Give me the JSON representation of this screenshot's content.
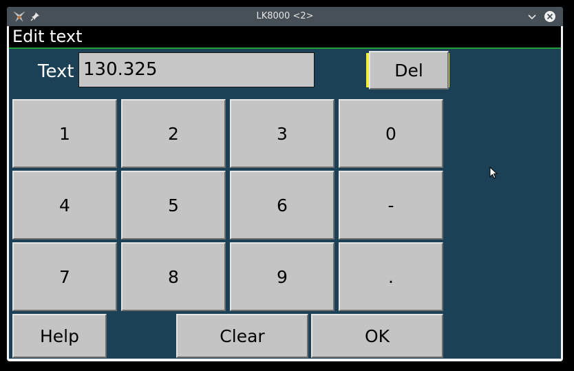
{
  "window": {
    "title": "LK8000 <2>",
    "icons": {
      "app": "app-logo-icon",
      "pin": "pin-icon",
      "minimize": "chevron-down-icon",
      "close": "close-icon"
    }
  },
  "dialog": {
    "title": "Edit text",
    "text_label": "Text",
    "text_value": "130.325",
    "keys": {
      "del": "Del",
      "k1": "1",
      "k2": "2",
      "k3": "3",
      "k0": "0",
      "k4": "4",
      "k5": "5",
      "k6": "6",
      "minus": "-",
      "k7": "7",
      "k8": "8",
      "k9": "9",
      "dot": ".",
      "help": "Help",
      "clear": "Clear",
      "ok": "OK"
    }
  },
  "colors": {
    "background": "#1c4157",
    "header_bg": "#000000",
    "header_line": "#22a13a",
    "button_face": "#c4c4c4",
    "focus": "#f2ee3a",
    "titlebar": "#475057"
  }
}
